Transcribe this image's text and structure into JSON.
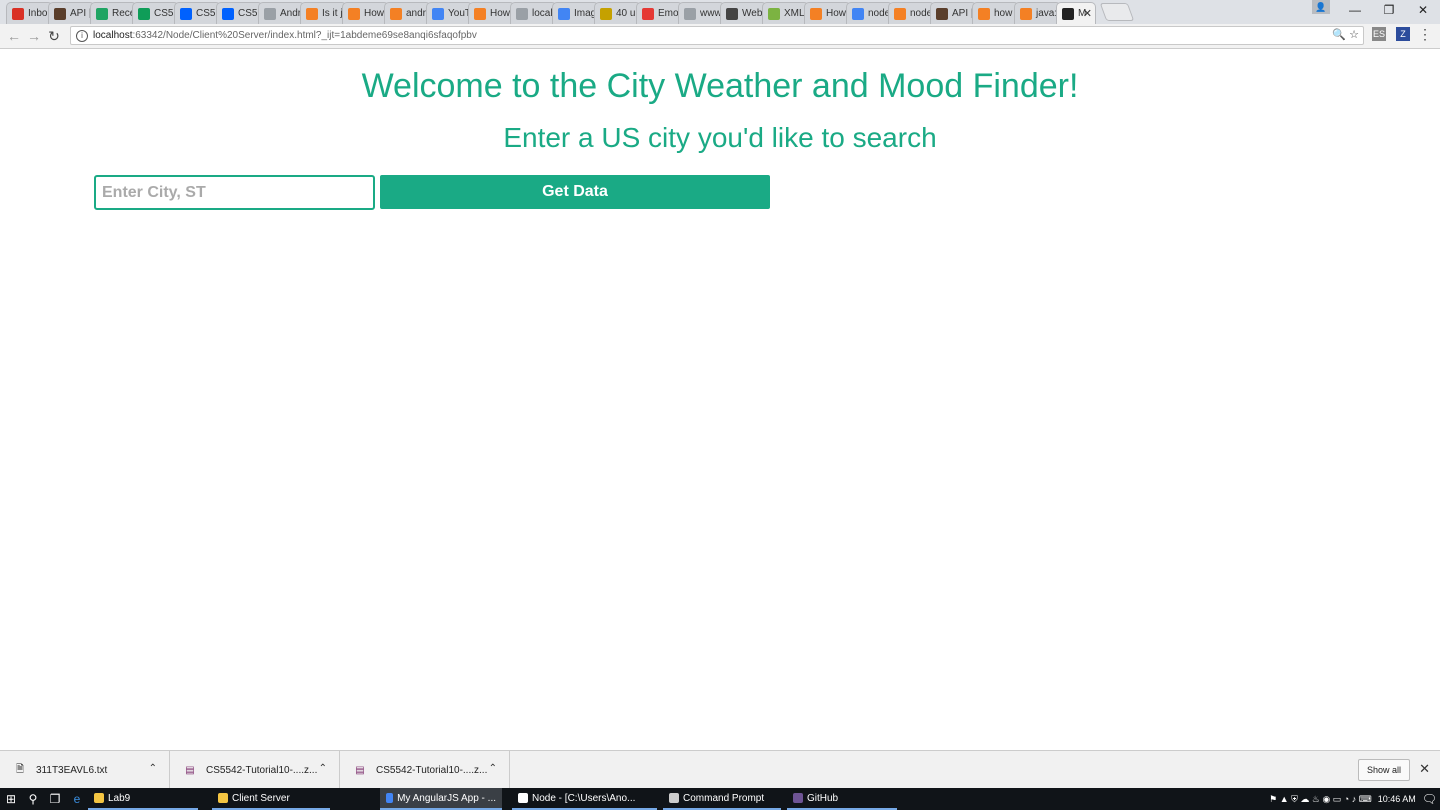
{
  "browser": {
    "tabs": [
      {
        "title": "Inbo",
        "icon": "gmail-icon",
        "color": "#d93025"
      },
      {
        "title": "API |",
        "icon": "api-icon",
        "color": "#5a3e2b"
      },
      {
        "title": "Rece",
        "icon": "drive-icon",
        "color": "#1fa463"
      },
      {
        "title": "CS5!",
        "icon": "sheets-icon",
        "color": "#0f9d58"
      },
      {
        "title": "CS5!",
        "icon": "dropbox-icon",
        "color": "#0061fe"
      },
      {
        "title": "CS5!",
        "icon": "dropbox-icon",
        "color": "#0061fe"
      },
      {
        "title": "Andr",
        "icon": "page-icon",
        "color": "#9aa0a6"
      },
      {
        "title": "Is it j",
        "icon": "stackoverflow-icon",
        "color": "#f48024"
      },
      {
        "title": "How",
        "icon": "stackoverflow-icon",
        "color": "#f48024"
      },
      {
        "title": "andr",
        "icon": "stackoverflow-icon",
        "color": "#f48024"
      },
      {
        "title": "YouT",
        "icon": "chrome-icon",
        "color": "#4285f4"
      },
      {
        "title": "How",
        "icon": "stackoverflow-icon",
        "color": "#f48024"
      },
      {
        "title": "local",
        "icon": "page-icon",
        "color": "#9aa0a6"
      },
      {
        "title": "Imag",
        "icon": "chrome-icon",
        "color": "#4285f4"
      },
      {
        "title": "40 u",
        "icon": "udemy-icon",
        "color": "#c5a100"
      },
      {
        "title": "Emo",
        "icon": "emoji-icon",
        "color": "#e53935"
      },
      {
        "title": "www.",
        "icon": "page-icon",
        "color": "#9aa0a6"
      },
      {
        "title": "Web",
        "icon": "web-icon",
        "color": "#444444"
      },
      {
        "title": "XML",
        "icon": "xml-icon",
        "color": "#7cb342"
      },
      {
        "title": "How",
        "icon": "stackoverflow-icon",
        "color": "#f48024"
      },
      {
        "title": "node",
        "icon": "google-icon",
        "color": "#4285f4"
      },
      {
        "title": "node",
        "icon": "stackoverflow-icon",
        "color": "#f48024"
      },
      {
        "title": "API |",
        "icon": "api-icon",
        "color": "#5a3e2b"
      },
      {
        "title": "how",
        "icon": "stackoverflow-icon",
        "color": "#f48024"
      },
      {
        "title": "java:",
        "icon": "stackoverflow-icon",
        "color": "#f48024"
      },
      {
        "title": "M",
        "icon": "webstorm-icon",
        "color": "#222222",
        "active": true
      }
    ],
    "url_host": "localhost",
    "url_path": ":63342/Node/Client%20Server/index.html?_ijt=1abdeme69se8anqi6sfaqofpbv",
    "window_controls": {
      "minimize": "—",
      "maximize": "❐",
      "close": "✕"
    }
  },
  "page": {
    "title": "Welcome to the City Weather and Mood Finder!",
    "subtitle": "Enter a US city you'd like to search",
    "city_input": {
      "value": "",
      "placeholder": "Enter City, ST"
    },
    "get_button_label": "Get Data",
    "accent_color": "#1aaa85"
  },
  "downloads": {
    "items": [
      {
        "name": "311T3EAVL6.txt",
        "icon": "text-file-icon"
      },
      {
        "name": "CS5542-Tutorial10-....z...",
        "icon": "winrar-icon"
      },
      {
        "name": "CS5542-Tutorial10-....z...",
        "icon": "winrar-icon"
      }
    ],
    "show_all_label": "Show all"
  },
  "taskbar": {
    "apps": [
      {
        "label": "Lab9",
        "icon": "folder-icon",
        "color": "#f4c542"
      },
      {
        "label": "Client Server",
        "icon": "folder-icon",
        "color": "#f4c542"
      },
      {
        "label": "My AngularJS App - ...",
        "icon": "chrome-icon",
        "color": "#4285f4",
        "active": true
      },
      {
        "label": "Node - [C:\\Users\\Ano...",
        "icon": "webstorm-icon",
        "color": "#ffffff"
      },
      {
        "label": "Command Prompt",
        "icon": "cmd-icon",
        "color": "#cccccc"
      },
      {
        "label": "GitHub",
        "icon": "github-icon",
        "color": "#6e5494"
      }
    ],
    "clock": "10:46 AM"
  }
}
